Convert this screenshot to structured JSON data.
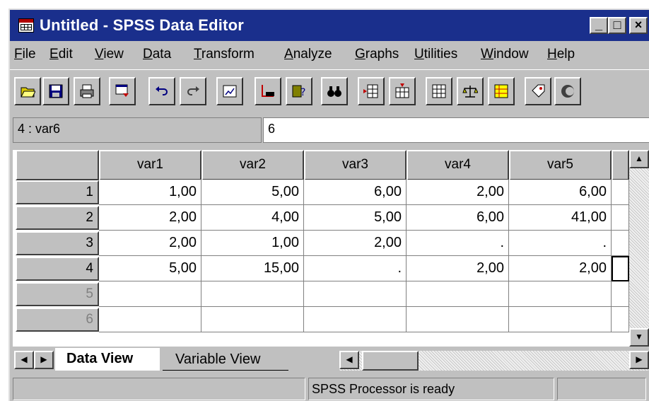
{
  "window": {
    "title": "Untitled - SPSS Data Editor",
    "min": "_",
    "max": "□",
    "close": "×"
  },
  "menu": [
    {
      "label": "File",
      "key": "F",
      "rest": "ile"
    },
    {
      "label": "Edit",
      "key": "E",
      "rest": "dit"
    },
    {
      "label": "View",
      "key": "V",
      "rest": "iew"
    },
    {
      "label": "Data",
      "key": "D",
      "rest": "ata"
    },
    {
      "label": "Transform",
      "key": "T",
      "rest": "ransform"
    },
    {
      "label": "Analyze",
      "key": "A",
      "rest": "nalyze"
    },
    {
      "label": "Graphs",
      "key": "G",
      "rest": "raphs"
    },
    {
      "label": "Utilities",
      "key": "U",
      "rest": "tilities"
    },
    {
      "label": "Window",
      "key": "W",
      "rest": "indow"
    },
    {
      "label": "Help",
      "key": "H",
      "rest": "elp"
    }
  ],
  "toolbar_icons": [
    "open-icon",
    "save-icon",
    "print-icon",
    "dialog-recall-icon",
    "undo-icon",
    "redo-icon",
    "goto-chart-icon",
    "goto-case-icon",
    "variables-icon",
    "find-icon",
    "insert-case-icon",
    "insert-variable-icon",
    "split-file-icon",
    "weight-cases-icon",
    "select-cases-icon",
    "value-labels-icon",
    "use-sets-icon"
  ],
  "cell_editor": {
    "reference": "4 : var6",
    "value": "6"
  },
  "grid": {
    "columns": [
      "var1",
      "var2",
      "var3",
      "var4",
      "var5"
    ],
    "rows": [
      {
        "num": "1",
        "cells": [
          "1,00",
          "5,00",
          "6,00",
          "2,00",
          "6,00"
        ]
      },
      {
        "num": "2",
        "cells": [
          "2,00",
          "4,00",
          "5,00",
          "6,00",
          "41,00"
        ]
      },
      {
        "num": "3",
        "cells": [
          "2,00",
          "1,00",
          "2,00",
          ".",
          "."
        ]
      },
      {
        "num": "4",
        "cells": [
          "5,00",
          "15,00",
          ".",
          "2,00",
          "2,00"
        ]
      },
      {
        "num": "5",
        "cells": [
          "",
          "",
          "",
          "",
          ""
        ]
      },
      {
        "num": "6",
        "cells": [
          "",
          "",
          "",
          "",
          ""
        ]
      }
    ]
  },
  "tabs": {
    "active": "Data View",
    "inactive": "Variable View"
  },
  "status": {
    "message": "SPSS Processor  is ready"
  }
}
